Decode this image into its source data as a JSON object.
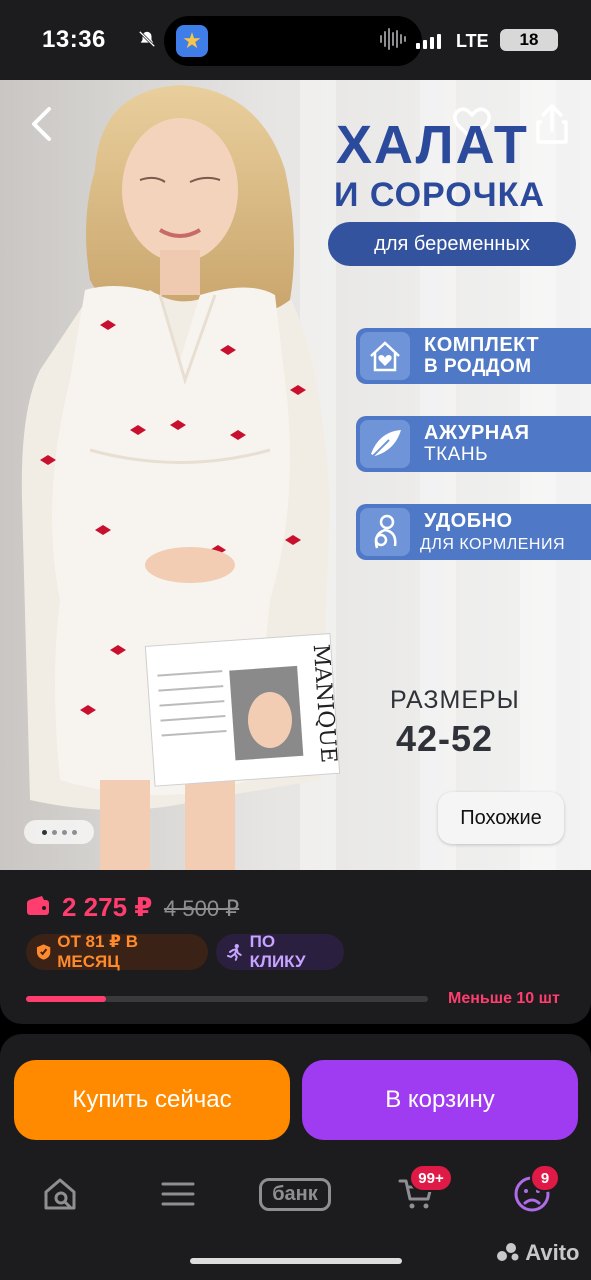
{
  "status_bar": {
    "time": "13:36",
    "network": "LTE",
    "battery": "18"
  },
  "hero": {
    "headline_line1": "ХАЛАТ",
    "headline_line2": "И СОРОЧКА",
    "pill": "для беременных",
    "features": [
      {
        "line1": "КОМПЛЕКТ",
        "line2": "В РОДДОМ",
        "icon": "house-heart-icon"
      },
      {
        "line1": "АЖУРНАЯ",
        "line2": "ТКАНЬ",
        "icon": "feather-icon"
      },
      {
        "line1": "УДОБНО",
        "line2": "ДЛЯ КОРМЛЕНИЯ",
        "icon": "mother-baby-icon"
      }
    ],
    "sizes_label": "РАЗМЕРЫ",
    "sizes_value": "42-52",
    "similar_button": "Похожие",
    "carousel_total": 4,
    "carousel_active": 1,
    "magazine_title": "MANIQUE"
  },
  "price_panel": {
    "price": "2 275 ₽",
    "old_price": "4 500 ₽",
    "badge_month": "ОТ 81 ₽ В МЕСЯЦ",
    "badge_click": "ПО КЛИКУ",
    "stock_progress": 0.2,
    "stock_text": "Меньше 10 шт"
  },
  "actions": {
    "buy_now": "Купить сейчас",
    "add_to_cart": "В корзину"
  },
  "nav": {
    "bank_label": "банк",
    "cart_badge": "99+",
    "profile_badge": "9"
  },
  "watermark": "Avito",
  "colors": {
    "accent_pink": "#ff3d6e",
    "buy_orange": "#ff8a00",
    "cart_purple": "#9f3cf2",
    "hero_blue": "#2c4a9c"
  }
}
